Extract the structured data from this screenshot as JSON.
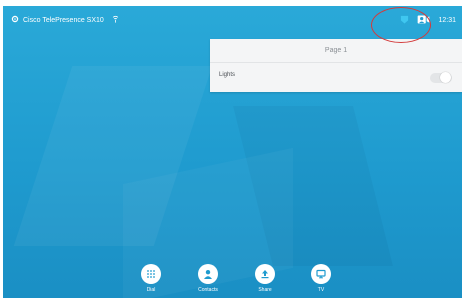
{
  "topbar": {
    "device_name": "Cisco TelePresence SX10",
    "time": "12:31"
  },
  "panel": {
    "title": "Page 1",
    "lights_label": "Lights",
    "lights_on": false
  },
  "dock": {
    "items": [
      {
        "label": "Dial",
        "icon": "dialpad-icon"
      },
      {
        "label": "Contacts",
        "icon": "person-icon"
      },
      {
        "label": "Share",
        "icon": "share-upload-icon"
      },
      {
        "label": "TV",
        "icon": "monitor-icon"
      }
    ]
  },
  "colors": {
    "background": "#1f9bcf",
    "annotation": "#d33b3b",
    "panel": "#f4f5f6"
  }
}
